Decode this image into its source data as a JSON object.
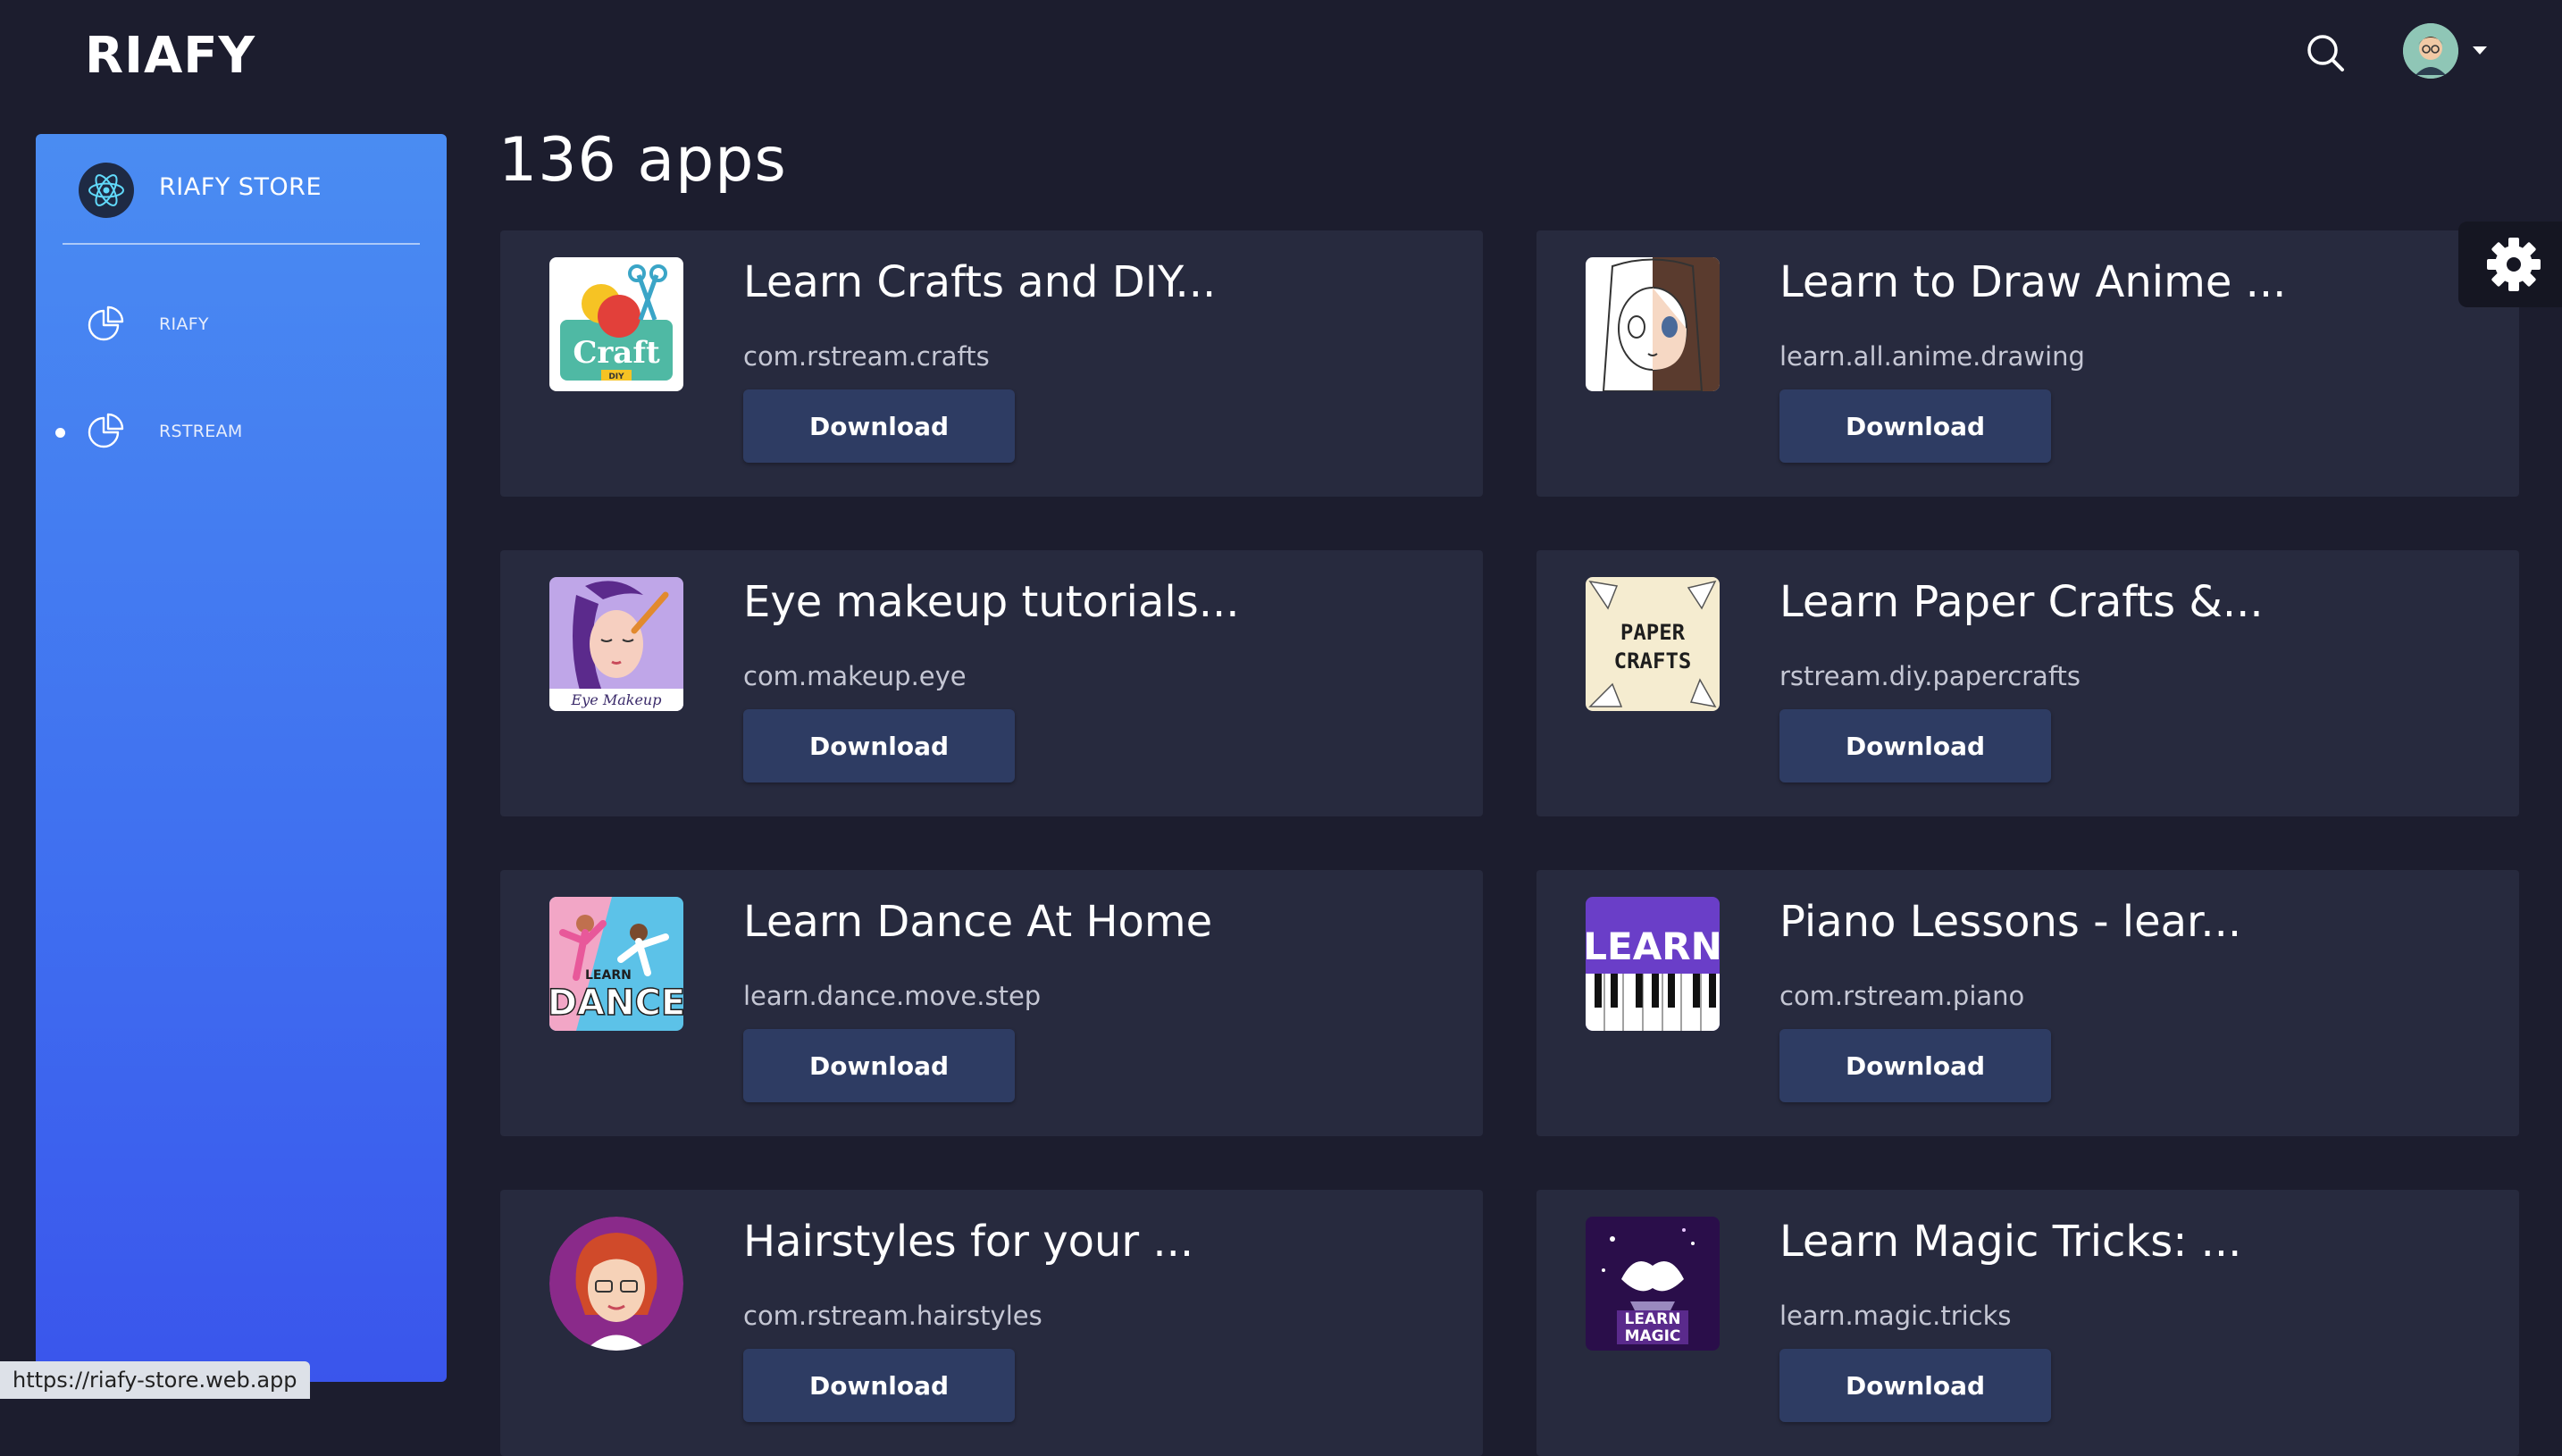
{
  "brand": "RIAFY",
  "sidebar": {
    "title": "RIAFY STORE",
    "items": [
      {
        "label": "RIAFY",
        "active": false
      },
      {
        "label": "RSTREAM",
        "active": true
      }
    ]
  },
  "main": {
    "count_title": "136 apps",
    "apps": [
      {
        "title": "Learn Crafts and DIY...",
        "package": "com.rstream.crafts",
        "button": "Download",
        "icon": "craft-diy-icon"
      },
      {
        "title": "Learn to Draw Anime ...",
        "package": "learn.all.anime.drawing",
        "button": "Download",
        "icon": "anime-drawing-icon"
      },
      {
        "title": "Eye makeup tutorials...",
        "package": "com.makeup.eye",
        "button": "Download",
        "icon": "eye-makeup-icon"
      },
      {
        "title": "Learn Paper Crafts &...",
        "package": "rstream.diy.papercrafts",
        "button": "Download",
        "icon": "paper-crafts-icon"
      },
      {
        "title": "Learn Dance At Home",
        "package": "learn.dance.move.step",
        "button": "Download",
        "icon": "dance-icon"
      },
      {
        "title": "Piano Lessons - lear...",
        "package": "com.rstream.piano",
        "button": "Download",
        "icon": "piano-icon"
      },
      {
        "title": "Hairstyles for your ...",
        "package": "com.rstream.hairstyles",
        "button": "Download",
        "icon": "hairstyles-icon"
      },
      {
        "title": "Learn Magic Tricks: ...",
        "package": "learn.magic.tricks",
        "button": "Download",
        "icon": "magic-tricks-icon"
      }
    ],
    "icon_texts": {
      "craft": "Craft",
      "diy": "DIY",
      "eye_makeup": "Eye Makeup",
      "paper_1": "PAPER",
      "paper_2": "CRAFTS",
      "dance_small": "LEARN",
      "dance_big": "DANCE",
      "piano": "LEARN",
      "magic_1": "LEARN",
      "magic_2": "MAGIC"
    }
  },
  "status_bar": {
    "url": "https://riafy-store.web.app"
  },
  "colors": {
    "background": "#1c1d2e",
    "card": "#272a3e",
    "button": "#2e3c63",
    "sidebar_top": "#4a8cf2",
    "sidebar_bottom": "#3a55ec"
  }
}
